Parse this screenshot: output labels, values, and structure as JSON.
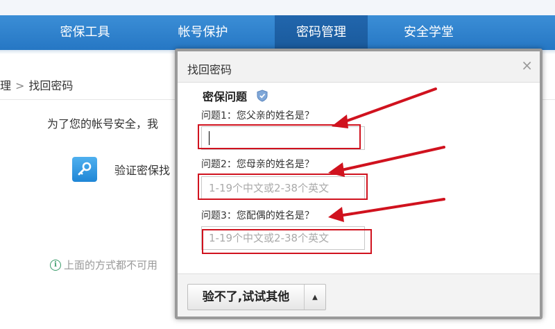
{
  "nav": {
    "items": [
      {
        "label": "密保工具"
      },
      {
        "label": "帐号保护"
      },
      {
        "label": "密码管理"
      },
      {
        "label": "安全学堂"
      }
    ],
    "active_index": 2
  },
  "breadcrumb": {
    "partial_prev": "理",
    "separator": ">",
    "current": "找回密码"
  },
  "page": {
    "intro_text": "为了您的帐号安全，我",
    "method_label": "验证密保找",
    "alt_text": "上面的方式都不可用",
    "info_icon": "info-icon"
  },
  "dialog": {
    "title": "找回密码",
    "close_label": "×",
    "section_title": "密保问题",
    "questions": [
      {
        "label": "问题1：您父亲的姓名是？",
        "value": "",
        "placeholder": ""
      },
      {
        "label": "问题2：您母亲的姓名是？",
        "value": "",
        "placeholder": "1-19个中文或2-38个英文"
      },
      {
        "label": "问题3：您配偶的姓名是？",
        "value": "",
        "placeholder": "1-19个中文或2-38个英文"
      }
    ],
    "alt_button_label": "验不了,试试其他",
    "alt_button_arrow": "▲"
  },
  "colors": {
    "nav_blue": "#2677c4",
    "nav_active": "#1a5a9c",
    "highlight_red": "#d0121e",
    "confirm_green": "#6cbf2e"
  }
}
